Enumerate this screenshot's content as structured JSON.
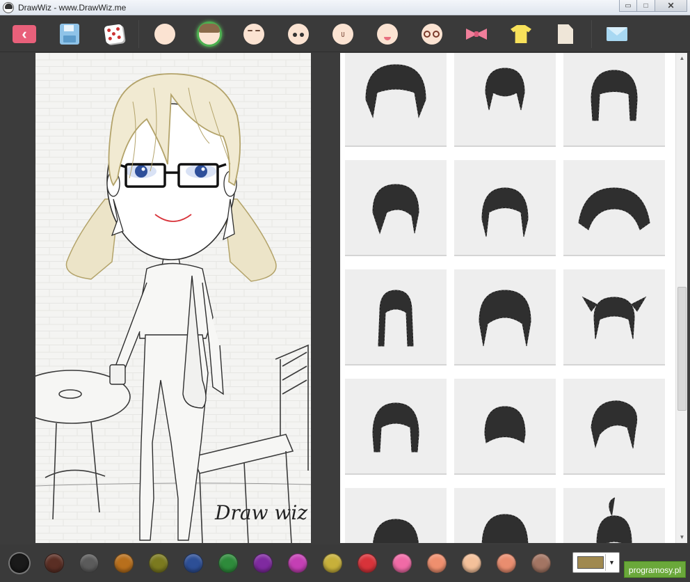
{
  "window": {
    "title": "DrawWiz - www.DrawWiz.me",
    "minimize_glyph": "▭",
    "maximize_glyph": "□",
    "close_glyph": "✕"
  },
  "toolbar": {
    "back_glyph": "‹",
    "items": [
      {
        "name": "back-button",
        "icon": "back-arrow-icon"
      },
      {
        "name": "save-button",
        "icon": "floppy-disk-icon"
      },
      {
        "name": "random-button",
        "icon": "dice-icon"
      },
      {
        "name": "face-shape-button",
        "icon": "face-icon"
      },
      {
        "name": "hair-button",
        "icon": "hair-icon",
        "selected": true
      },
      {
        "name": "eyebrows-button",
        "icon": "eyebrows-icon"
      },
      {
        "name": "eyes-button",
        "icon": "eyes-icon"
      },
      {
        "name": "nose-button",
        "icon": "nose-icon"
      },
      {
        "name": "mouth-button",
        "icon": "mouth-icon"
      },
      {
        "name": "glasses-button",
        "icon": "glasses-icon"
      },
      {
        "name": "accessories-button",
        "icon": "bow-icon"
      },
      {
        "name": "clothes-button",
        "icon": "shirt-icon"
      },
      {
        "name": "background-button",
        "icon": "page-icon"
      },
      {
        "name": "share-button",
        "icon": "envelope-icon"
      }
    ]
  },
  "canvas": {
    "signature": "Draw wiz",
    "hair_color": "#b3a36a",
    "eye_color": "#2e4f9a"
  },
  "hair_panel": {
    "tiles": [
      "hair-style-1",
      "hair-style-2",
      "hair-style-3",
      "hair-style-4",
      "hair-style-5",
      "hair-style-6",
      "hair-style-7",
      "hair-style-8",
      "hair-style-9",
      "hair-style-10",
      "hair-style-11",
      "hair-style-12",
      "hair-style-13",
      "hair-style-14",
      "hair-style-15"
    ],
    "scroll_up_glyph": "▲",
    "scroll_down_glyph": "▼"
  },
  "palette": {
    "colors": [
      "#1a1a1a",
      "#5a2e24",
      "#5b5b5b",
      "#b86f1c",
      "#7b7a1f",
      "#2d4f96",
      "#2e8b3b",
      "#7f2aa0",
      "#c43fb4",
      "#c7b03a",
      "#d8333a",
      "#f06aa6",
      "#ef8f6e",
      "#f4c09a",
      "#e98d6f",
      "#a37563"
    ],
    "selected_index": 0,
    "current_color": "#a0894f",
    "dropdown_glyph": "▼"
  },
  "badge": {
    "text": "programosy.pl"
  }
}
